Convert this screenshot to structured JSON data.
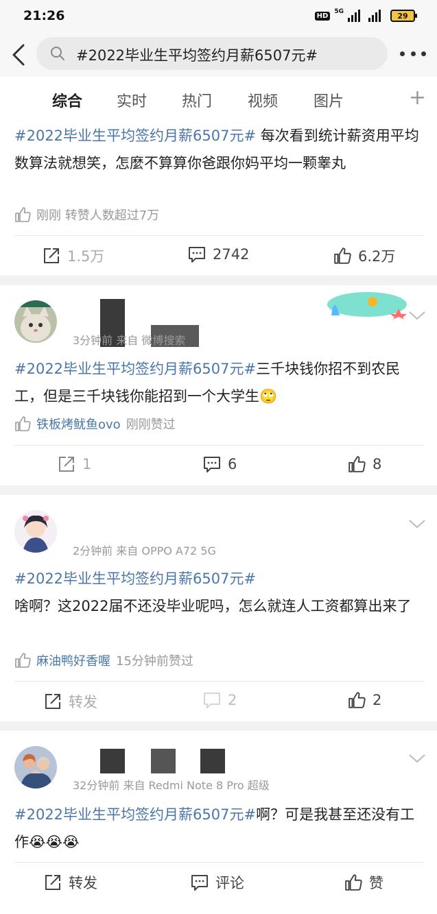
{
  "status": {
    "time": "21:26",
    "hd": "HD",
    "network": "5G",
    "battery": "29"
  },
  "search": {
    "query": "#2022毕业生平均签约月薪6507元#"
  },
  "tabs": [
    "综合",
    "实时",
    "热门",
    "视频",
    "图片"
  ],
  "posts": [
    {
      "tag": "#2022毕业生平均签约月薪6507元#",
      "body": " 每次看到统计薪资用平均数算法就想笑，怎麼不算算你爸跟你妈平均一颗睾丸",
      "like_line": "刚刚 转赞人数超过7万",
      "actions": {
        "repost": "1.5万",
        "comment": "2742",
        "like": "6.2万"
      }
    },
    {
      "meta": "3分钟前 来自 微博搜索",
      "tag": "#2022毕业生平均签约月薪6507元#",
      "body": "三千块钱你招不到农民工，但是三千块钱你能招到一个大学生🙄",
      "liker": "铁板烤鱿鱼ovo",
      "like_suffix": "刚刚赞过",
      "actions": {
        "repost": "1",
        "comment": "6",
        "like": "8"
      }
    },
    {
      "meta": "2分钟前 来自 OPPO A72 5G",
      "tag": "#2022毕业生平均签约月薪6507元#",
      "body": "啥啊？这2022届不还没毕业呢吗，怎么就连人工资都算出来了",
      "liker": "麻油鸭好香喔",
      "like_suffix": "15分钟前赞过",
      "actions": {
        "repost": "转发",
        "comment": "2",
        "like": "2"
      }
    },
    {
      "meta": "32分钟前 来自 Redmi Note 8 Pro 超级",
      "tag": "#2022毕业生平均签约月薪6507元#",
      "body": "啊？可是我甚至还没有工作😭😭😭",
      "actions": {
        "repost": "转发",
        "comment": "评论",
        "like": "赞"
      }
    }
  ],
  "colors": {
    "accent": "#ff8200",
    "tag": "#4a77ab",
    "muted": "#999999"
  }
}
